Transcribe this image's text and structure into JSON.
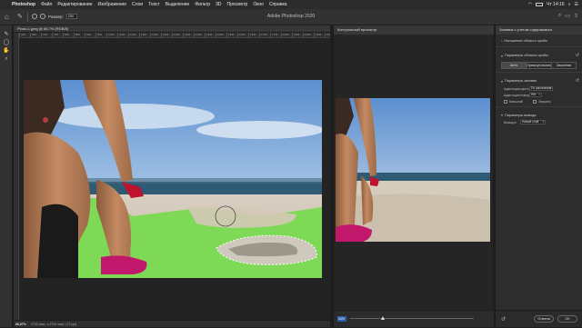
{
  "menubar": {
    "items": [
      "Photoshop",
      "Файл",
      "Редактирование",
      "Изображение",
      "Слои",
      "Текст",
      "Выделение",
      "Фильтр",
      "3D",
      "Просмотр",
      "Окно",
      "Справка"
    ],
    "clock": "Чт 14:16"
  },
  "titlebar": {
    "app_title": "Adobe Photoshop 2020",
    "size_label": "Размер:",
    "size_value": "250"
  },
  "document": {
    "tab_title": "Photo-1.jpeg @ 66,7% (RGB/8)",
    "ruler_ticks": [
      "600",
      "650",
      "700",
      "750",
      "800",
      "850",
      "900",
      "950",
      "1000",
      "1050",
      "1100",
      "1150",
      "1200",
      "1250",
      "1300",
      "1350",
      "1400",
      "1450",
      "1500",
      "1550",
      "1600",
      "1650",
      "1700",
      "1750",
      "1800",
      "1850",
      "1900",
      "1950",
      "2000",
      "2050"
    ],
    "zoom": "66,67%",
    "doc_info": "3700 пикс. x 2700 пикс. (72 ppi)"
  },
  "preview": {
    "title": "Контрольный просмотр",
    "zoom": "34%"
  },
  "panel": {
    "title": "Заливка с учетом содержимого",
    "section_overlay": "Наложение области пробы",
    "section_sampling": "Параметры области пробы",
    "sampling_options": [
      "Авто",
      "Прямоугольник",
      "Заказная"
    ],
    "sampling_active": 0,
    "section_fill": "Параметры заливки",
    "color_adapt_label": "Адаптация цветов:",
    "color_adapt_value": "По умолчанию",
    "rotation_label": "Адаптация поворота:",
    "rotation_value": "Нет",
    "scale_label": "Масштаб",
    "mirror_label": "Зеркало",
    "section_output": "Параметры вывода",
    "output_label": "Вывод в:",
    "output_value": "Новый слой",
    "cancel": "Отмена",
    "ok": "ОК"
  },
  "colors": {
    "selection_green": "#7ed957",
    "accent_blue": "#2a5ea8"
  }
}
